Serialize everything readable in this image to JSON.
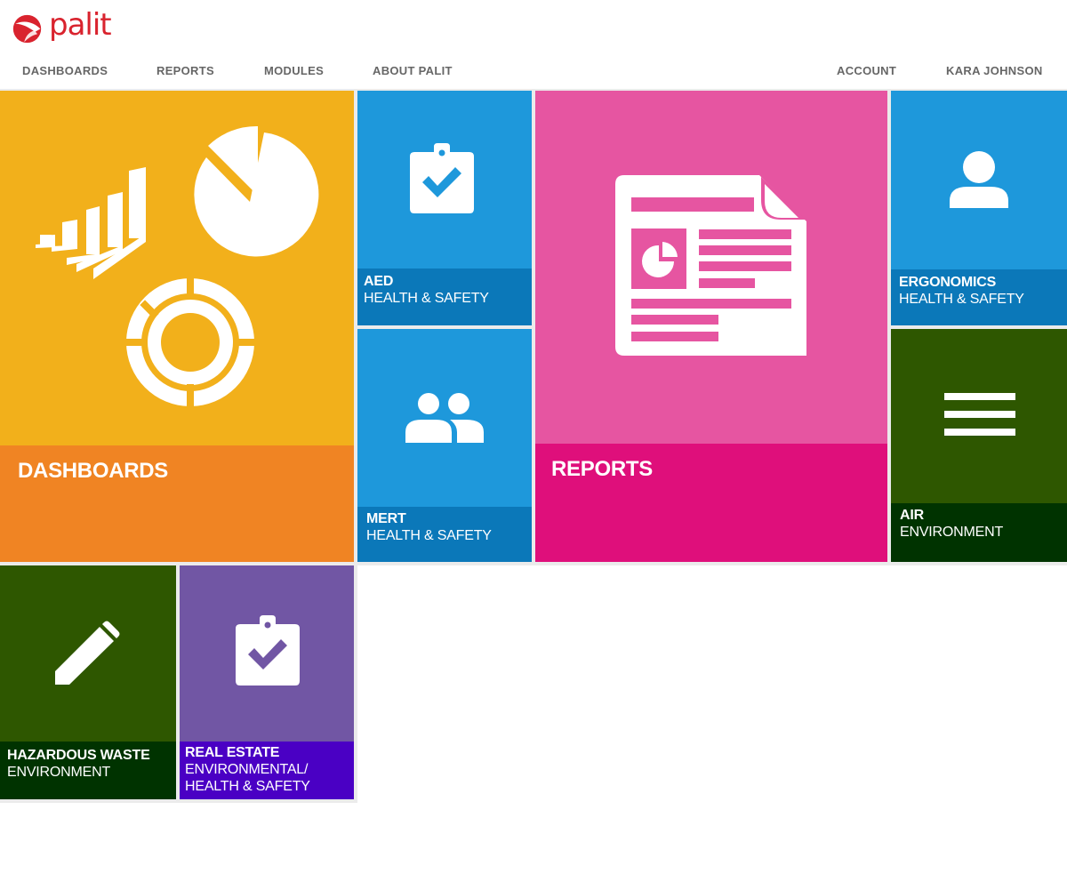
{
  "brand": {
    "name": "palit",
    "color": "#d9232e"
  },
  "nav": {
    "left": [
      "DASHBOARDS",
      "REPORTS",
      "MODULES",
      "ABOUT PALIT"
    ],
    "account": "ACCOUNT",
    "user": "KARA JOHNSON"
  },
  "tiles": {
    "dashboards": {
      "title": "DASHBOARDS",
      "icon": "charts-icon",
      "color": "#f2b01b",
      "label_color": "#f08423"
    },
    "aed": {
      "title": "AED",
      "subtitle": "HEALTH & SAFETY",
      "icon": "clipboard-check-icon",
      "color": "#1e98db",
      "label_color": "#0b78b9"
    },
    "reports": {
      "title": "REPORTS",
      "icon": "report-document-icon",
      "color": "#e655a1",
      "label_color": "#df0f7b"
    },
    "ergonomics": {
      "title": "ERGONOMICS",
      "subtitle": "HEALTH & SAFETY",
      "icon": "user-icon",
      "color": "#1e98db",
      "label_color": "#0b78b9"
    },
    "mert": {
      "title": "MERT",
      "subtitle": "HEALTH & SAFETY",
      "icon": "users-icon",
      "color": "#1e98db",
      "label_color": "#0b78b9"
    },
    "air": {
      "title": "AIR",
      "subtitle": "ENVIRONMENT",
      "icon": "menu-lines-icon",
      "color": "#2e5700",
      "label_color": "#003300"
    },
    "hazardous_waste": {
      "title": "HAZARDOUS WASTE",
      "subtitle": "ENVIRONMENT",
      "icon": "pencil-icon",
      "color": "#2e5700",
      "label_color": "#003300"
    },
    "real_estate": {
      "title": "REAL ESTATE",
      "subtitle_1": "ENVIRONMENTAL/",
      "subtitle_2": "HEALTH & SAFETY",
      "icon": "clipboard-check-icon",
      "color": "#7156a4",
      "label_color": "#4a00c4"
    }
  }
}
